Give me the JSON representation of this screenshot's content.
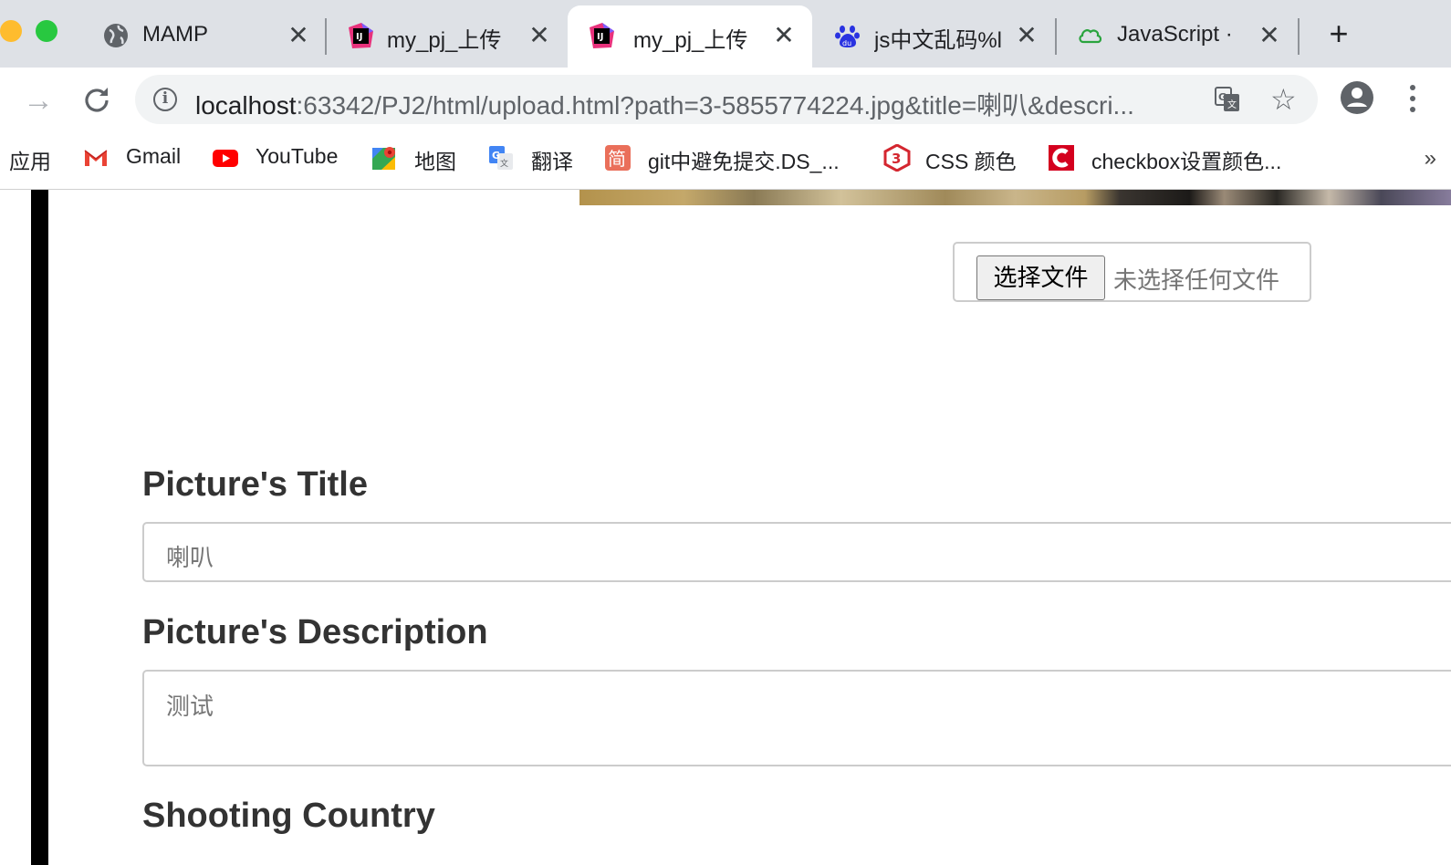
{
  "tabs": [
    {
      "title": "MAMP",
      "icon": "globe-icon",
      "active": false
    },
    {
      "title": "my_pj_上传",
      "icon": "jetbrains-icon",
      "active": false
    },
    {
      "title": "my_pj_上传",
      "icon": "jetbrains-icon",
      "active": true
    },
    {
      "title": "js中文乱码%l",
      "icon": "baidu-icon",
      "active": false
    },
    {
      "title": "JavaScript · ",
      "icon": "cloud-icon",
      "active": false
    }
  ],
  "toolbar": {
    "url_host": "localhost",
    "url_rest": ":63342/PJ2/html/upload.html?path=3-5855774224.jpg&title=喇叭&descri..."
  },
  "bookmarks": [
    {
      "label": "应用",
      "icon": "apps-icon"
    },
    {
      "label": "Gmail",
      "icon": "gmail-icon"
    },
    {
      "label": "YouTube",
      "icon": "youtube-icon"
    },
    {
      "label": "地图",
      "icon": "maps-icon"
    },
    {
      "label": "翻译",
      "icon": "translate-icon"
    },
    {
      "label": "git中避免提交.DS_...",
      "icon": "jian-icon"
    },
    {
      "label": "CSS 颜色",
      "icon": "css3-icon"
    },
    {
      "label": "checkbox设置颜色...",
      "icon": "c-icon"
    }
  ],
  "bookmarks_more": "»",
  "file_input": {
    "button_label": "选择文件",
    "status": "未选择任何文件"
  },
  "form": {
    "title_label": "Picture's Title",
    "title_value": "喇叭",
    "description_label": "Picture's Description",
    "description_value": "测试",
    "country_label": "Shooting Country"
  },
  "colors": {
    "tabstrip": "#dee1e6",
    "omnibox": "#f1f3f4",
    "left_bar": "#000000",
    "label": "#333333"
  }
}
